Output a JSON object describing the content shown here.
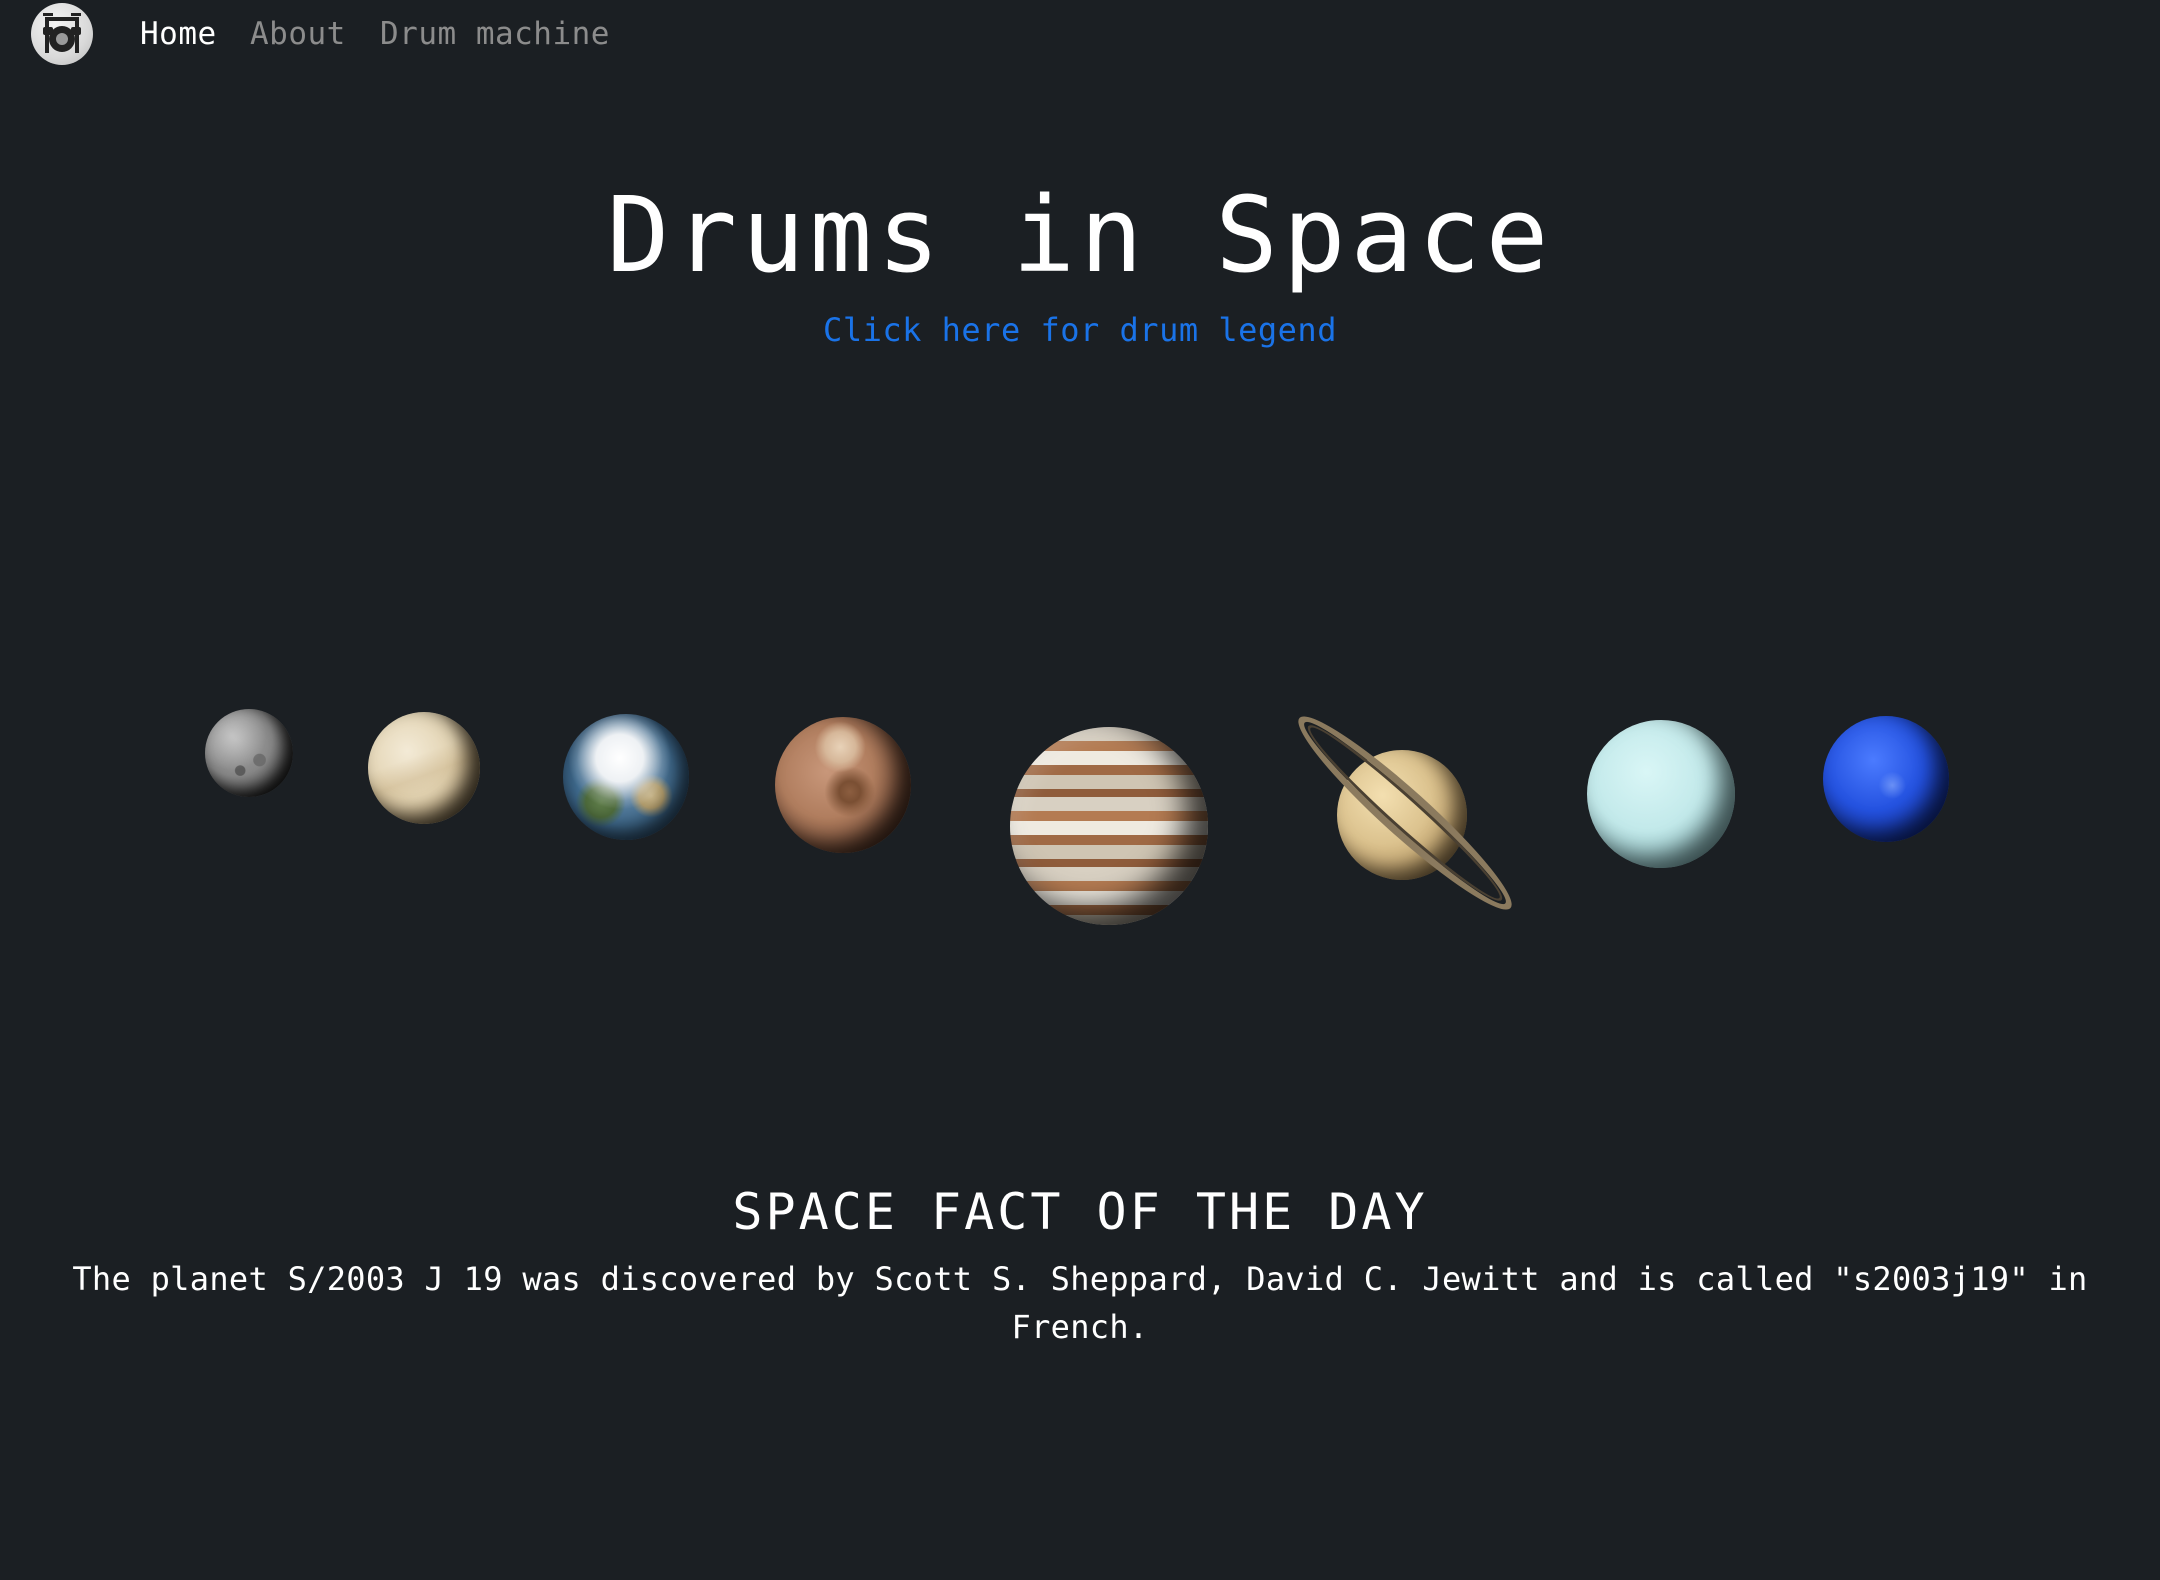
{
  "navbar": {
    "logo_icon": "drum-kit-icon",
    "links": [
      {
        "label": "Home",
        "active": true
      },
      {
        "label": "About",
        "active": false
      },
      {
        "label": "Drum machine",
        "active": false
      }
    ]
  },
  "hero": {
    "title": "Drums in Space",
    "legend_link": "Click here for drum legend"
  },
  "planets": [
    "mercury-icon",
    "venus-icon",
    "earth-icon",
    "mars-icon",
    "jupiter-icon",
    "saturn-icon",
    "uranus-icon",
    "neptune-icon"
  ],
  "fact": {
    "heading": "SPACE FACT OF THE DAY",
    "text": "The planet S/2003 J 19 was discovered by Scott S. Sheppard, David C. Jewitt and is called \"s2003j19\" in French."
  },
  "colors": {
    "background": "#1b1f23",
    "link": "#1a73e8",
    "nav_inactive": "#8c8c8c"
  }
}
